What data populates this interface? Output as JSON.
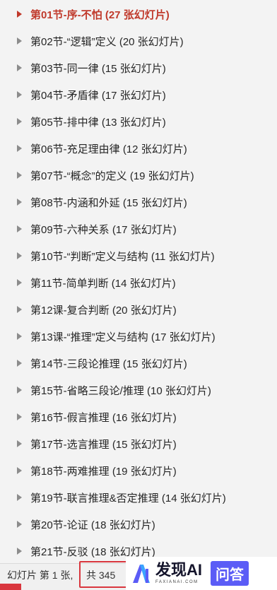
{
  "sections": [
    {
      "label": "第01节-序-不怕 (27 张幻灯片)",
      "selected": true
    },
    {
      "label": "第02节-“逻辑”定义 (20 张幻灯片)",
      "selected": false
    },
    {
      "label": "第03节-同一律 (15 张幻灯片)",
      "selected": false
    },
    {
      "label": "第04节-矛盾律 (17 张幻灯片)",
      "selected": false
    },
    {
      "label": "第05节-排中律 (13 张幻灯片)",
      "selected": false
    },
    {
      "label": "第06节-充足理由律 (12 张幻灯片)",
      "selected": false
    },
    {
      "label": "第07节-“概念”的定义 (19 张幻灯片)",
      "selected": false
    },
    {
      "label": "第08节-内涵和外延 (15 张幻灯片)",
      "selected": false
    },
    {
      "label": "第09节-六种关系 (17 张幻灯片)",
      "selected": false
    },
    {
      "label": "第10节-“判断”定义与结构 (11 张幻灯片)",
      "selected": false
    },
    {
      "label": "第11节-简单判断 (14 张幻灯片)",
      "selected": false
    },
    {
      "label": "第12课-复合判断 (20 张幻灯片)",
      "selected": false
    },
    {
      "label": "第13课-“推理”定义与结构 (17 张幻灯片)",
      "selected": false
    },
    {
      "label": "第14节-三段论推理 (15 张幻灯片)",
      "selected": false
    },
    {
      "label": "第15节-省略三段论/推理 (10 张幻灯片)",
      "selected": false
    },
    {
      "label": "第16节-假言推理 (16 张幻灯片)",
      "selected": false
    },
    {
      "label": "第17节-选言推理 (15 张幻灯片)",
      "selected": false
    },
    {
      "label": "第18节-两难推理 (19 张幻灯片)",
      "selected": false
    },
    {
      "label": "第19节-联言推理&否定推理 (14 张幻灯片)",
      "selected": false
    },
    {
      "label": "第20节-论证 (18 张幻灯片)",
      "selected": false
    },
    {
      "label": "第21节-反驳 (18 张幻灯片)",
      "selected": false
    }
  ],
  "statusbar": {
    "slide_position": "幻灯片 第 1 张,",
    "total": "共 345"
  },
  "watermark": {
    "brand": "发现AI",
    "domain": "FAXIANAI.COM",
    "badge": "问答"
  },
  "colors": {
    "selected_text": "#c0392b",
    "highlight_box": "#d9363e",
    "logo_purple": "#5b5cf6",
    "logo_blue": "#3ba4ff"
  },
  "icons": {
    "expand": "triangle-right-icon",
    "logo": "faxianai-logo"
  }
}
